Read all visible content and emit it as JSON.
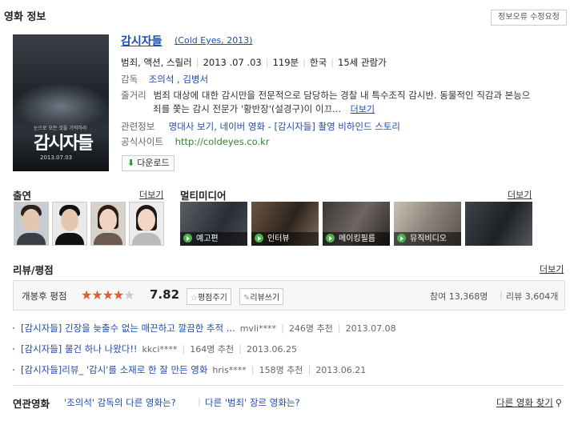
{
  "header": {
    "title": "영화 정보",
    "report_button": "정보오류 수정요청"
  },
  "movie": {
    "title": "감시자들",
    "original_title": "(Cold Eyes, 2013)",
    "genre": "범죄, 액션, 스릴러",
    "release_date": "2013 .07 .03",
    "runtime": "119분",
    "country": "한국",
    "rating": "15세 관람가",
    "director_label": "감독",
    "director": "조의석 , 김병서",
    "synopsis_label": "줄거리",
    "synopsis_line1": "범죄 대상에 대한 감시만을 전문적으로 담당하는 경찰 내 특수조직 감시반. 동물적인 직감과 본능으",
    "synopsis_line2": "죄를 쫓는 감시 전문가 '황반장'(설경구)이 이끄...",
    "synopsis_more": "더보기",
    "related_label": "관련정보",
    "related_links": "명대사 보기, 네이버 영화 - [감시자들] 촬영 비하인드 스토리",
    "site_label": "공식사이트",
    "site_url": "http://coldeyes.co.kr",
    "download_button": "다운로드",
    "poster_title": "감시자들",
    "poster_date": "2013.07.03",
    "poster_tag": "눈으로 모든 것을 기억하라"
  },
  "cast": {
    "title": "출연",
    "more": "더보기"
  },
  "multimedia": {
    "title": "멀티미디어",
    "more": "더보기",
    "items": [
      {
        "label": "예고편"
      },
      {
        "label": "인터뷰"
      },
      {
        "label": "메이킹필름"
      },
      {
        "label": "뮤직비디오"
      }
    ]
  },
  "reviews": {
    "title": "리뷰/평점",
    "more": "더보기",
    "score_label": "개봉후 평점",
    "score": "7.82",
    "rate_button": "평점주기",
    "write_button": "리뷰쓰기",
    "participants": "참여 13,368명",
    "review_count": "리뷰 3,604개",
    "items": [
      {
        "title": "[감시자들] 긴장을 늦출수 없는 매끈하고 깔끔한 추적 ...",
        "author": "mvli****",
        "recommend": "246명 추천",
        "date": "2013.07.08"
      },
      {
        "title": "[감시자들] 물건 하나 나왔다!!",
        "author": "kkci****",
        "recommend": "164명 추천",
        "date": "2013.06.25"
      },
      {
        "title": "[감시자들]리뷰_ '감시'를 소재로 한 잘 만든 영화",
        "author": "hris****",
        "recommend": "158명 추천",
        "date": "2013.06.21"
      }
    ]
  },
  "related": {
    "title": "연관영화",
    "link1": "'조의석' 감독의 다른 영화는?",
    "link2": "다른 '범죄' 장르 영화는?",
    "find_more": "다른 영화 찾기"
  },
  "colors": {
    "link": "#1d4bb3",
    "star": "#e25b2d",
    "play": "#4db34d"
  }
}
